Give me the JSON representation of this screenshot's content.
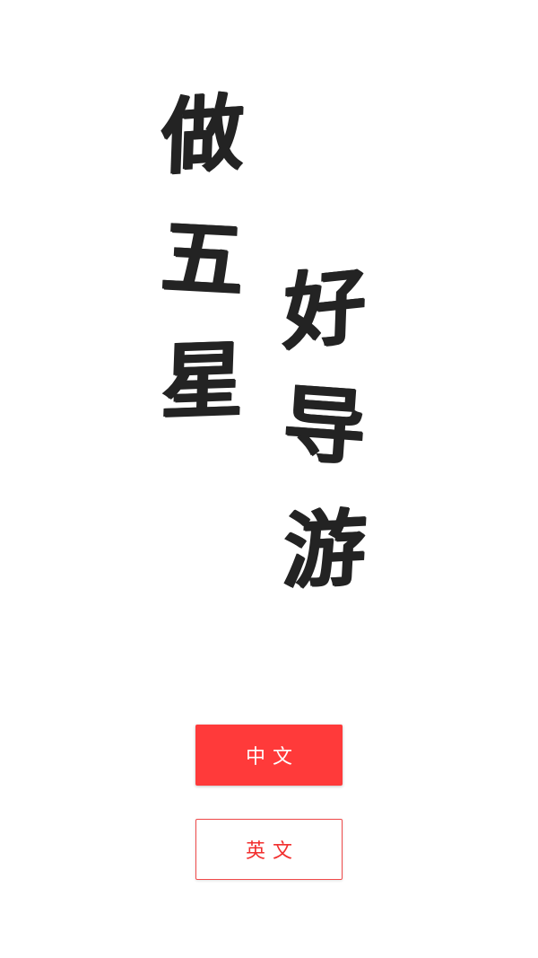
{
  "slogan": {
    "left_column": [
      "做",
      "五",
      "星"
    ],
    "right_column": [
      "好",
      "导",
      "游"
    ]
  },
  "language_options": {
    "chinese_label": "中文",
    "english_label": "英文"
  },
  "colors": {
    "accent": "#ff3a3a",
    "text_dark": "#232323",
    "background": "#ffffff"
  }
}
